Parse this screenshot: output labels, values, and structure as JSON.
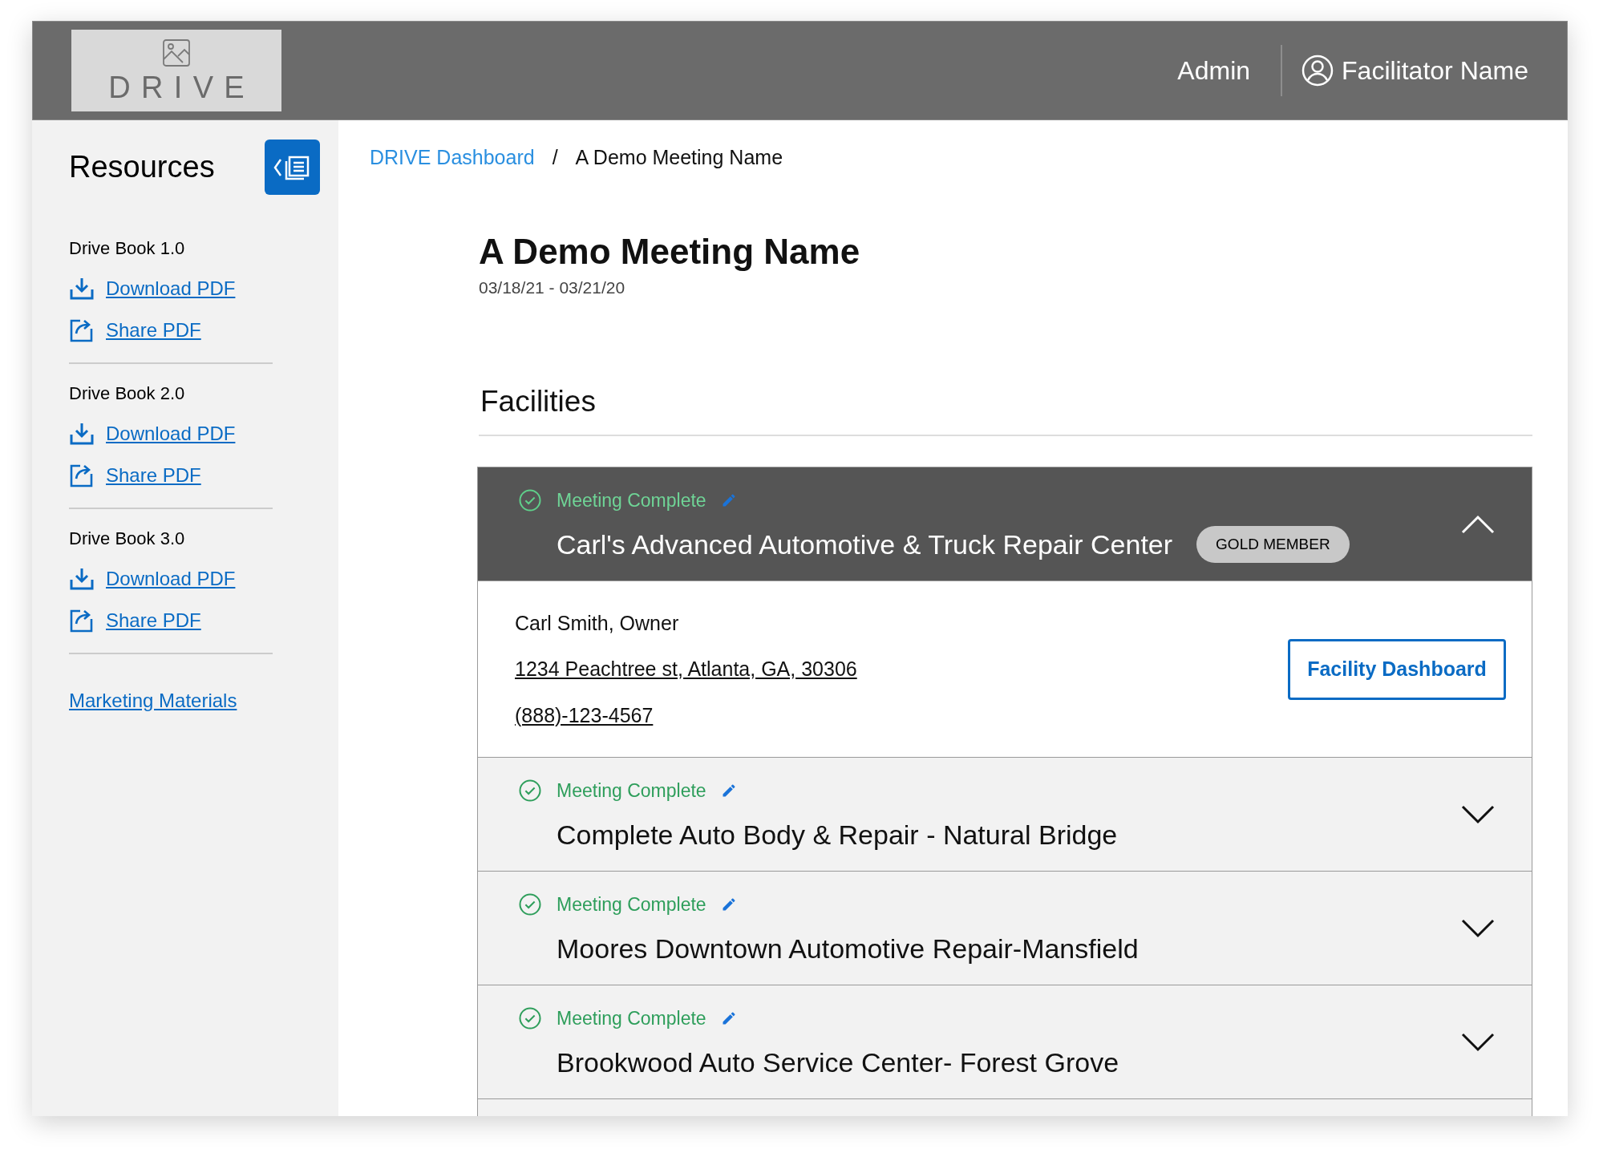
{
  "header": {
    "logo": "DRIVE",
    "nav": [
      {
        "kind": "link",
        "label": "Admin"
      },
      {
        "kind": "user",
        "label": "Facilitator Name"
      }
    ]
  },
  "sidebar": {
    "title": "Resources",
    "sections": [
      {
        "title": "Drive Book 1.0",
        "links": [
          {
            "kind": "download",
            "label": "Download PDF"
          },
          {
            "kind": "share",
            "label": "Share PDF"
          }
        ]
      },
      {
        "title": "Drive Book 2.0",
        "links": [
          {
            "kind": "download",
            "label": "Download PDF"
          },
          {
            "kind": "share",
            "label": "Share PDF"
          }
        ]
      },
      {
        "title": "Drive Book 3.0",
        "links": [
          {
            "kind": "download",
            "label": "Download PDF"
          },
          {
            "kind": "share",
            "label": "Share PDF"
          }
        ]
      }
    ],
    "footer_link": "Marketing Materials"
  },
  "breadcrumb": [
    "DRIVE Dashboard",
    "/",
    "A Demo Meeting Name"
  ],
  "meeting": {
    "title": "A Demo Meeting Name",
    "dates": "03/18/21 - 03/21/20"
  },
  "facilities": {
    "heading": "Facilities",
    "items": [
      {
        "status": "Meeting Complete",
        "name": "Carl's Advanced Automotive & Truck Repair Center",
        "badge": "GOLD MEMBER",
        "expanded": true,
        "contact": {
          "owner": "Carl Smith, Owner",
          "address": "1234 Peachtree st, Atlanta, GA, 30306",
          "phone": "(888)-123-4567"
        },
        "button": "Facility Dashboard"
      },
      {
        "status": "Meeting Complete",
        "name": "Complete Auto Body & Repair - Natural Bridge",
        "expanded": false
      },
      {
        "status": "Meeting Complete",
        "name": "Moores Downtown Automotive Repair-Mansfield",
        "expanded": false
      },
      {
        "status": "Meeting Complete",
        "name": "Brookwood Auto Service Center- Forest Grove",
        "expanded": false
      }
    ]
  }
}
